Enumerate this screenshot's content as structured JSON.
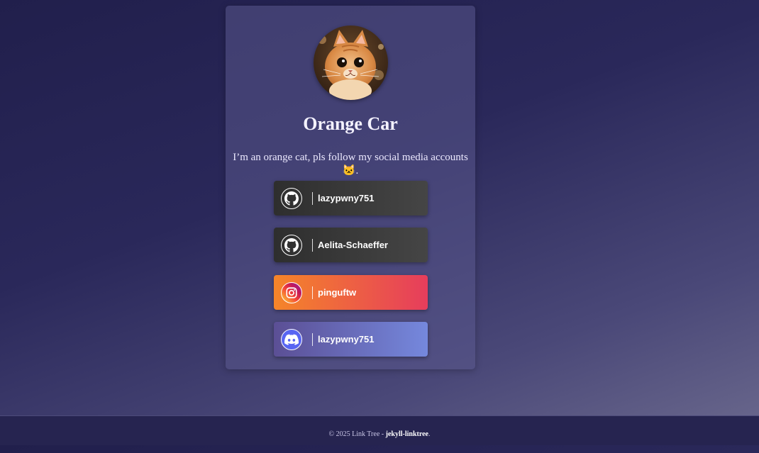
{
  "profile": {
    "name": "Orange Car",
    "bio": "I’m an orange cat, pls follow my social media accounts 🐱."
  },
  "links": [
    {
      "service": "github",
      "icon": "github-icon",
      "label": "lazypwny751"
    },
    {
      "service": "github",
      "icon": "github-icon",
      "label": "Aelita-Schaeffer"
    },
    {
      "service": "instagram",
      "icon": "instagram-icon",
      "label": "pinguftw"
    },
    {
      "service": "discord",
      "icon": "discord-icon",
      "label": "lazypwny751"
    }
  ],
  "footer": {
    "prefix": "© 2025 Link Tree - ",
    "link_text": "jekyll-linktree",
    "suffix": "."
  },
  "colors": {
    "github": "#2e2e2e",
    "instagram_start": "#f58529",
    "instagram_end": "#e63d5c",
    "discord_start": "#5b4f95",
    "discord_end": "#7588dd"
  }
}
